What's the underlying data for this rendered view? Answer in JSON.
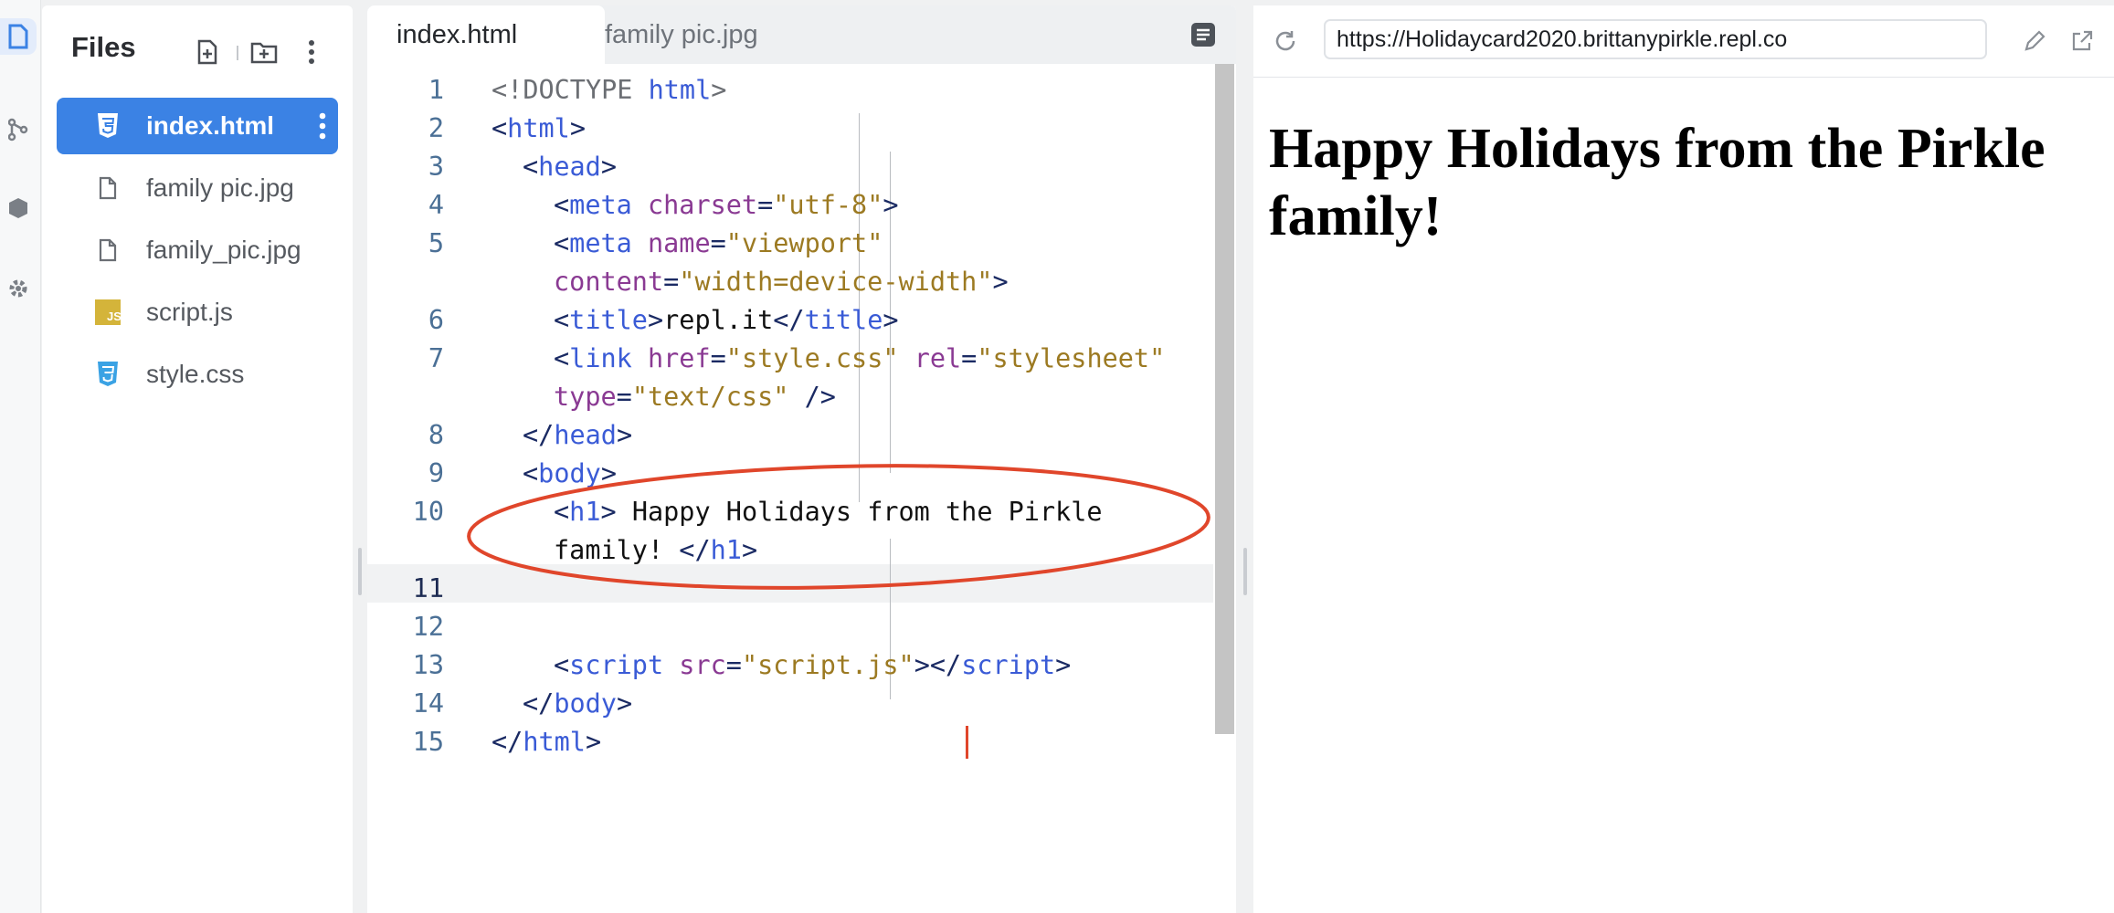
{
  "sidebar": {
    "title": "Files",
    "files": [
      {
        "name": "index.html",
        "icon": "html5-icon",
        "active": true
      },
      {
        "name": "family pic.jpg",
        "icon": "file-icon",
        "active": false
      },
      {
        "name": "family_pic.jpg",
        "icon": "file-icon",
        "active": false
      },
      {
        "name": "script.js",
        "icon": "js-icon",
        "active": false
      },
      {
        "name": "style.css",
        "icon": "css3-icon",
        "active": false
      }
    ]
  },
  "editor": {
    "tabs": [
      {
        "label": "index.html",
        "active": true
      },
      {
        "label": "family pic.jpg",
        "active": false
      }
    ],
    "line_numbers": [
      "1",
      "2",
      "3",
      "4",
      "5",
      "6",
      "7",
      "8",
      "9",
      "10",
      "11",
      "12",
      "13",
      "14",
      "15"
    ],
    "current_line": "11",
    "code": {
      "l1": {
        "open": "<!DOCTYPE ",
        "name": "html",
        "close": ">"
      },
      "l2": {
        "lt": "<",
        "tag": "html",
        "gt": ">"
      },
      "l3": {
        "lt": "<",
        "tag": "head",
        "gt": ">"
      },
      "l4": {
        "lt": "<",
        "tag": "meta",
        "attr1": " charset",
        "eq1": "=",
        "val1": "\"utf-8\"",
        "gt": ">"
      },
      "l5a": {
        "lt": "<",
        "tag": "meta",
        "attr1": " name",
        "eq1": "=",
        "val1": "\"viewport\""
      },
      "l5b": {
        "attr2": "content",
        "eq2": "=",
        "val2": "\"width=device-width\"",
        "gt": ">"
      },
      "l6": {
        "lt": "<",
        "tag": "title",
        "gt": ">",
        "text": "repl.it",
        "lt2": "</",
        "tag2": "title",
        "gt2": ">"
      },
      "l7a": {
        "lt": "<",
        "tag": "link",
        "attr1": " href",
        "eq1": "=",
        "val1": "\"style.css\"",
        "attr2": " rel",
        "eq2": "=",
        "val2": "\"stylesheet\""
      },
      "l7b": {
        "attr3": "type",
        "eq3": "=",
        "val3": "\"text/css\"",
        "end": " />"
      },
      "l8": {
        "lt": "</",
        "tag": "head",
        "gt": ">"
      },
      "l9": {
        "lt": "<",
        "tag": "body",
        "gt": ">"
      },
      "l10a": {
        "lt": "<",
        "tag": "h1",
        "gt": ">",
        "text": " Happy Holidays from the Pirkle"
      },
      "l10b": {
        "text": "family! ",
        "lt": "</",
        "tag": "h1",
        "gt": ">"
      },
      "l13": {
        "lt": "<",
        "tag": "script",
        "attr1": " src",
        "eq1": "=",
        "val1": "\"script.js\"",
        "gt": ">",
        "lt2": "</",
        "tag2": "script",
        "gt2": ">"
      },
      "l14": {
        "lt": "</",
        "tag": "body",
        "gt": ">"
      },
      "l15": {
        "lt": "</",
        "tag": "html",
        "gt": ">"
      }
    }
  },
  "preview": {
    "url": "https://Holidaycard2020.brittanypirkle.repl.co",
    "heading": "Happy Holidays from the Pirkle family!"
  },
  "colors": {
    "accent": "#3b82e4",
    "annotation": "#e0462b",
    "tag": "#3a5bd6",
    "attribute": "#8a3a93",
    "string": "#9c7a22"
  }
}
